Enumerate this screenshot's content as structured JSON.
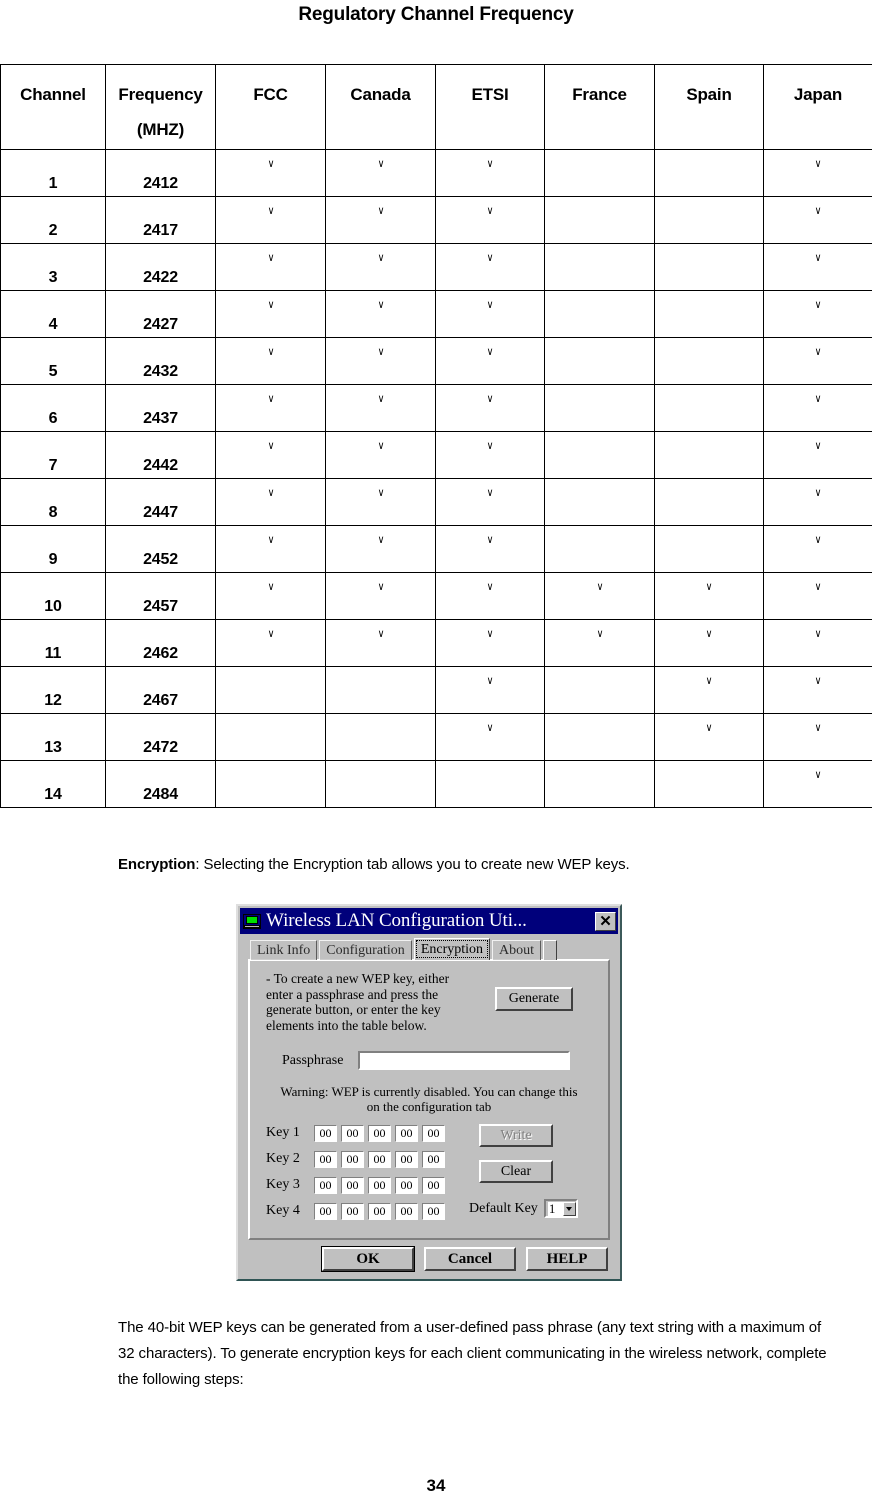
{
  "page": {
    "title": "Regulatory Channel Frequency",
    "number": "34"
  },
  "table": {
    "headers": [
      {
        "label": "Channel",
        "sub": ""
      },
      {
        "label": "Frequency",
        "sub": "(MHZ)"
      },
      {
        "label": "FCC",
        "sub": ""
      },
      {
        "label": "Canada",
        "sub": ""
      },
      {
        "label": "ETSI",
        "sub": ""
      },
      {
        "label": "France",
        "sub": ""
      },
      {
        "label": "Spain",
        "sub": ""
      },
      {
        "label": "Japan",
        "sub": ""
      }
    ],
    "check_glyph": "∨",
    "rows": [
      {
        "channel": "1",
        "frequency": "2412",
        "fcc": true,
        "canada": true,
        "etsi": true,
        "france": false,
        "spain": false,
        "japan": true
      },
      {
        "channel": "2",
        "frequency": "2417",
        "fcc": true,
        "canada": true,
        "etsi": true,
        "france": false,
        "spain": false,
        "japan": true
      },
      {
        "channel": "3",
        "frequency": "2422",
        "fcc": true,
        "canada": true,
        "etsi": true,
        "france": false,
        "spain": false,
        "japan": true
      },
      {
        "channel": "4",
        "frequency": "2427",
        "fcc": true,
        "canada": true,
        "etsi": true,
        "france": false,
        "spain": false,
        "japan": true
      },
      {
        "channel": "5",
        "frequency": "2432",
        "fcc": true,
        "canada": true,
        "etsi": true,
        "france": false,
        "spain": false,
        "japan": true
      },
      {
        "channel": "6",
        "frequency": "2437",
        "fcc": true,
        "canada": true,
        "etsi": true,
        "france": false,
        "spain": false,
        "japan": true
      },
      {
        "channel": "7",
        "frequency": "2442",
        "fcc": true,
        "canada": true,
        "etsi": true,
        "france": false,
        "spain": false,
        "japan": true
      },
      {
        "channel": "8",
        "frequency": "2447",
        "fcc": true,
        "canada": true,
        "etsi": true,
        "france": false,
        "spain": false,
        "japan": true
      },
      {
        "channel": "9",
        "frequency": "2452",
        "fcc": true,
        "canada": true,
        "etsi": true,
        "france": false,
        "spain": false,
        "japan": true
      },
      {
        "channel": "10",
        "frequency": "2457",
        "fcc": true,
        "canada": true,
        "etsi": true,
        "france": true,
        "spain": true,
        "japan": true
      },
      {
        "channel": "11",
        "frequency": "2462",
        "fcc": true,
        "canada": true,
        "etsi": true,
        "france": true,
        "spain": true,
        "japan": true
      },
      {
        "channel": "12",
        "frequency": "2467",
        "fcc": false,
        "canada": false,
        "etsi": true,
        "france": false,
        "spain": true,
        "japan": true
      },
      {
        "channel": "13",
        "frequency": "2472",
        "fcc": false,
        "canada": false,
        "etsi": true,
        "france": false,
        "spain": true,
        "japan": true
      },
      {
        "channel": "14",
        "frequency": "2484",
        "fcc": false,
        "canada": false,
        "etsi": false,
        "france": false,
        "spain": false,
        "japan": true
      }
    ]
  },
  "paragraphs": {
    "encryption_term": "Encryption",
    "encryption_rest": ": Selecting the Encryption tab allows you to create new WEP keys.",
    "closing": "The 40-bit WEP keys can be generated from a user-defined pass phrase (any text string with a maximum of 32 characters). To generate encryption keys for each client communicating in the wireless network, complete the following steps:"
  },
  "dialog": {
    "title": "Wireless LAN Configuration Uti...",
    "close_label": "✕",
    "tabs": [
      {
        "label": "Link Info",
        "active": false
      },
      {
        "label": "Configuration",
        "active": false
      },
      {
        "label": "Encryption",
        "active": true
      },
      {
        "label": "About",
        "active": false
      }
    ],
    "intro_text": "- To create a new  WEP key, either enter a passphrase and press the generate button, or enter the key elements into the table below.",
    "generate_label": "Generate",
    "passphrase_label": "Passphrase",
    "passphrase_value": "",
    "warning_line1": "Warning: WEP is currently disabled.  You can change this",
    "warning_line2": "on the configuration tab",
    "keys": [
      {
        "label": "Key 1",
        "values": [
          "00",
          "00",
          "00",
          "00",
          "00"
        ]
      },
      {
        "label": "Key 2",
        "values": [
          "00",
          "00",
          "00",
          "00",
          "00"
        ]
      },
      {
        "label": "Key 3",
        "values": [
          "00",
          "00",
          "00",
          "00",
          "00"
        ]
      },
      {
        "label": "Key 4",
        "values": [
          "00",
          "00",
          "00",
          "00",
          "00"
        ]
      }
    ],
    "write_label": "Write",
    "write_disabled": true,
    "clear_label": "Clear",
    "default_key_label": "Default Key",
    "default_key_value": "1",
    "ok_label": "OK",
    "cancel_label": "Cancel",
    "help_label": "HELP"
  },
  "colors": {
    "titlebar": "#00007b",
    "dialog_face": "#c0c0c0",
    "icon_screen": "#00e000"
  }
}
